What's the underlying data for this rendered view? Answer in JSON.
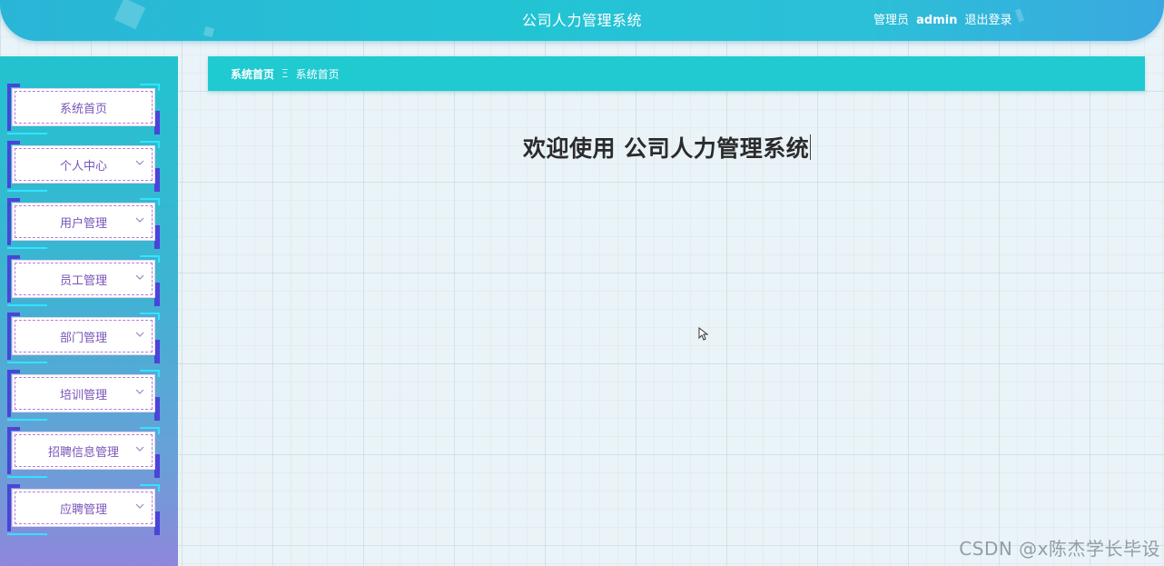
{
  "header": {
    "title": "公司人力管理系统",
    "user_role": "管理员",
    "user_name": "admin",
    "logout_label": "退出登录"
  },
  "sidebar": {
    "items": [
      {
        "label": "系统首页",
        "has_submenu": false
      },
      {
        "label": "个人中心",
        "has_submenu": true
      },
      {
        "label": "用户管理",
        "has_submenu": true
      },
      {
        "label": "员工管理",
        "has_submenu": true
      },
      {
        "label": "部门管理",
        "has_submenu": true
      },
      {
        "label": "培训管理",
        "has_submenu": true
      },
      {
        "label": "招聘信息管理",
        "has_submenu": true
      },
      {
        "label": "应聘管理",
        "has_submenu": true
      }
    ]
  },
  "breadcrumb": {
    "current": "系统首页",
    "separator": "Ξ",
    "page": "系统首页"
  },
  "main": {
    "welcome_prefix": "欢迎使用",
    "welcome_system": "公司人力管理系统"
  },
  "watermark": "CSDN @x陈杰学长毕设",
  "colors": {
    "header": "#22c4d4",
    "breadcrumb_bar": "#1fcad1",
    "sidebar_top": "#22c3cf",
    "sidebar_bottom": "#8f86da",
    "menu_text": "#7a55b8",
    "menu_accent": "#4a44d8",
    "menu_line": "#32e4ff"
  },
  "icons": {
    "menu_chevron": "chevron-down-icon",
    "pointer": "mouse-pointer-icon"
  }
}
